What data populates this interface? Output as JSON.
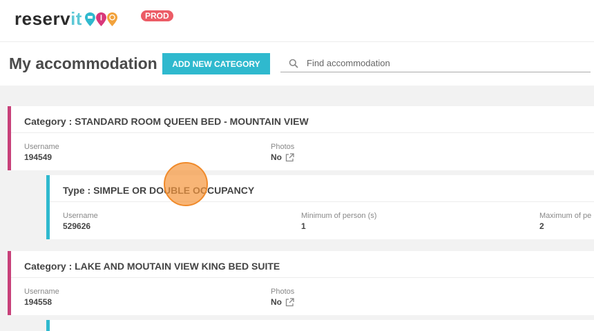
{
  "brand": {
    "logo_main": "reserv",
    "logo_accent": "it",
    "env_badge": "PROD",
    "colors": {
      "logo_accent": "#5dc8d6",
      "pin_1": "#2fb9ce",
      "pin_2": "#d9387a",
      "pin_3": "#f2a23c",
      "badge": "#ec5c66"
    }
  },
  "header": {
    "title": "My accommodation",
    "add_button": "ADD NEW CATEGORY",
    "search_placeholder": "Find accommodation",
    "accent_color": "#2fb9ce"
  },
  "categories": [
    {
      "title": "Category : STANDARD ROOM QUEEN BED - MOUNTAIN VIEW",
      "username_label": "Username",
      "username": "194549",
      "photos_label": "Photos",
      "photos": "No",
      "types": [
        {
          "title": "Type : SIMPLE OR DOUBLE OCCUPANCY",
          "username_label": "Username",
          "username": "529626",
          "min_label": "Minimum of person (s)",
          "min": "1",
          "max_label": "Maximum of pe",
          "max": "2"
        }
      ]
    },
    {
      "title": "Category : LAKE AND MOUTAIN VIEW KING BED SUITE",
      "username_label": "Username",
      "username": "194558",
      "photos_label": "Photos",
      "photos": "No"
    }
  ],
  "colors": {
    "category_accent": "#c8417a",
    "type_accent": "#2fb9ce",
    "click_indicator": "#f08a2a"
  }
}
